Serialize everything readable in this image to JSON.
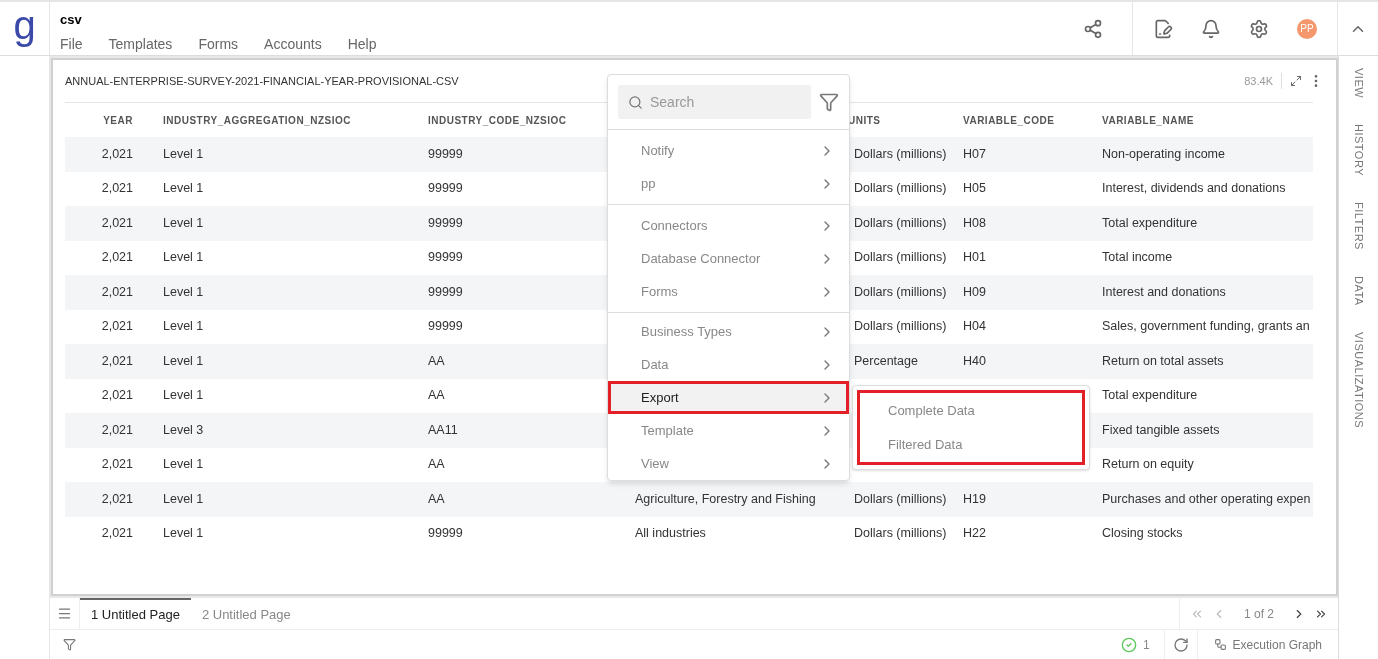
{
  "app": {
    "logo": "g",
    "title": "csv",
    "menu": [
      "File",
      "Templates",
      "Forms",
      "Accounts",
      "Help"
    ],
    "avatar": "PP"
  },
  "panel": {
    "title": "ANNUAL-ENTERPRISE-SURVEY-2021-FINANCIAL-YEAR-PROVISIONAL-CSV",
    "count": "83.4K"
  },
  "table": {
    "columns": [
      "YEAR",
      "INDUSTRY_AGGREGATION_NZSIOC",
      "INDUSTRY_CODE_NZSIOC",
      null,
      "UNITS",
      "VARIABLE_CODE",
      "VARIABLE_NAME"
    ],
    "rows": [
      [
        "2,021",
        "Level 1",
        "99999",
        null,
        "Dollars (millions)",
        "H07",
        "Non-operating income"
      ],
      [
        "2,021",
        "Level 1",
        "99999",
        null,
        "Dollars (millions)",
        "H05",
        "Interest, dividends and donations"
      ],
      [
        "2,021",
        "Level 1",
        "99999",
        null,
        "Dollars (millions)",
        "H08",
        "Total expenditure"
      ],
      [
        "2,021",
        "Level 1",
        "99999",
        null,
        "Dollars (millions)",
        "H01",
        "Total income"
      ],
      [
        "2,021",
        "Level 1",
        "99999",
        null,
        "Dollars (millions)",
        "H09",
        "Interest and donations"
      ],
      [
        "2,021",
        "Level 1",
        "99999",
        null,
        "Dollars (millions)",
        "H04",
        "Sales, government funding, grants an"
      ],
      [
        "2,021",
        "Level 1",
        "AA",
        null,
        "Percentage",
        "H40",
        "Return on total assets"
      ],
      [
        "2,021",
        "Level 1",
        "AA",
        null,
        null,
        null,
        "Total expenditure"
      ],
      [
        "2,021",
        "Level 3",
        "AA11",
        null,
        null,
        null,
        "Fixed tangible assets"
      ],
      [
        "2,021",
        "Level 1",
        "AA",
        null,
        null,
        null,
        "Return on equity"
      ],
      [
        "2,021",
        "Level 1",
        "AA",
        "Agriculture, Forestry and Fishing",
        "Dollars (millions)",
        "H19",
        "Purchases and other operating expen"
      ],
      [
        "2,021",
        "Level 1",
        "99999",
        "All industries",
        "Dollars (millions)",
        "H22",
        "Closing stocks"
      ]
    ]
  },
  "context_menu": {
    "search": {
      "placeholder": "Search"
    },
    "groups": [
      [
        {
          "label": "Notify",
          "selected": false
        },
        {
          "label": "pp",
          "selected": false
        }
      ],
      [
        {
          "label": "Connectors",
          "selected": false
        },
        {
          "label": "Database Connector",
          "selected": false
        },
        {
          "label": "Forms",
          "selected": false
        }
      ],
      [
        {
          "label": "Business Types",
          "selected": false
        },
        {
          "label": "Data",
          "selected": false
        },
        {
          "label": "Export",
          "selected": true
        },
        {
          "label": "Template",
          "selected": false
        },
        {
          "label": "View",
          "selected": false
        }
      ]
    ],
    "submenu": {
      "highlighted": true,
      "items": [
        "Complete Data",
        "Filtered Data"
      ]
    }
  },
  "side_tabs": [
    "VIEW",
    "HISTORY",
    "FILTERS",
    "DATA",
    "VISUALIZATIONS"
  ],
  "page_tabs": [
    {
      "label": "1 Untitled Page",
      "selected": true
    },
    {
      "label": "2 Untitled Page",
      "selected": false
    }
  ],
  "pagination": "1 of 2",
  "status_bar": {
    "success_count": "1",
    "execution_graph": "Execution Graph"
  }
}
